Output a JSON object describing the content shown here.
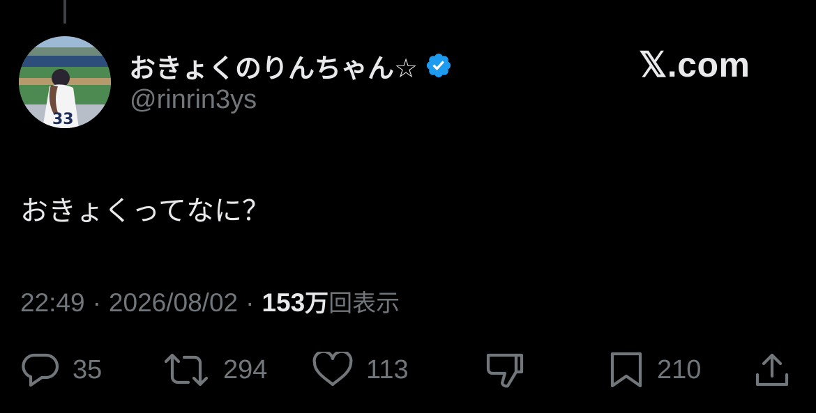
{
  "author": {
    "display_name": "おきょくのりんちゃん☆",
    "handle": "@rinrin3ys",
    "verified": true,
    "avatar_number": "33"
  },
  "brand": "𝕏.com",
  "tweet": {
    "text": "おきょくってなに？"
  },
  "meta": {
    "time": "22:49",
    "separator": "·",
    "date": "2026/08/02",
    "views_count": "153",
    "views_unit": "万",
    "views_label": "回表示"
  },
  "actions": {
    "reply_count": "35",
    "retweet_count": "294",
    "like_count": "113",
    "bookmark_count": "210"
  },
  "colors": {
    "background": "#000000",
    "primary_text": "#e7e9ea",
    "secondary_text": "#71767b",
    "verified_blue": "#1d9bf0"
  }
}
